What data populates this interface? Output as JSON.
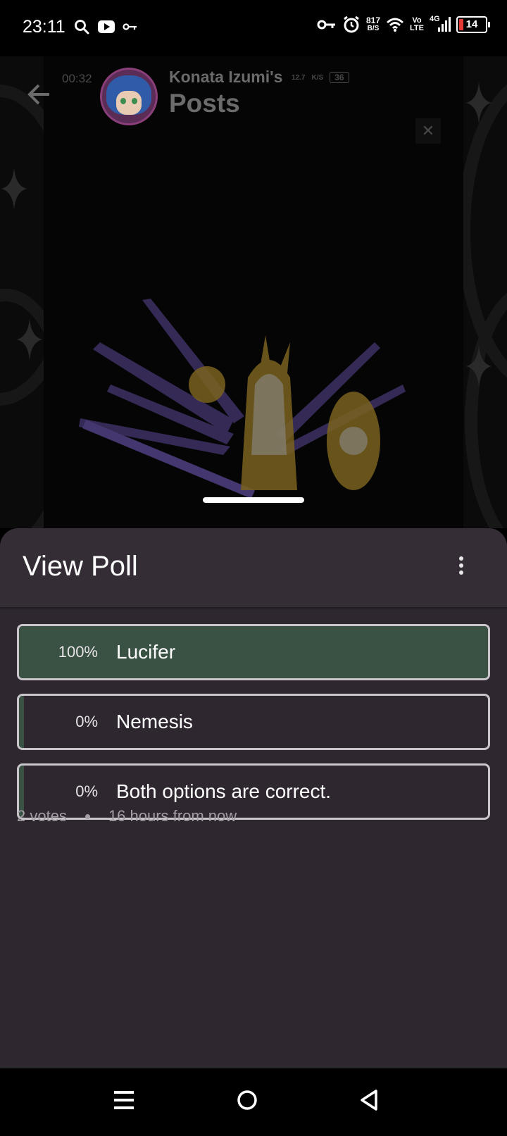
{
  "status_bar": {
    "time": "23:11",
    "net_speed_value": "817",
    "net_speed_unit": "B/S",
    "volte_top": "Vo",
    "volte_bottom": "LTE",
    "network": "4G",
    "battery": "14",
    "icons": [
      "search-icon",
      "youtube-icon",
      "vpn-key-icon",
      "vpn-key-icon",
      "alarm-icon",
      "wifi-icon",
      "signal-icon",
      "battery-icon"
    ]
  },
  "background_app": {
    "ghost_time": "00:32",
    "ghost_speed": "12.7",
    "ghost_speed_unit": "K/S",
    "ghost_battery": "36",
    "header_name": "Konata Izumi's",
    "header_title": "Posts",
    "close_label": "✕"
  },
  "poll": {
    "title": "View Poll",
    "options": [
      {
        "percent": "100%",
        "label": "Lucifer",
        "fraction": 1.0
      },
      {
        "percent": "0%",
        "label": "Nemesis",
        "fraction": 0.0
      },
      {
        "percent": "0%",
        "label": "Both options are correct.",
        "fraction": 0.0
      }
    ],
    "votes": "2 votes",
    "time_left": "16 hours from now"
  },
  "colors": {
    "sheet_bg": "#2e2730",
    "winner_fill": "#3a5244",
    "option_border": "#c9c5ca"
  }
}
